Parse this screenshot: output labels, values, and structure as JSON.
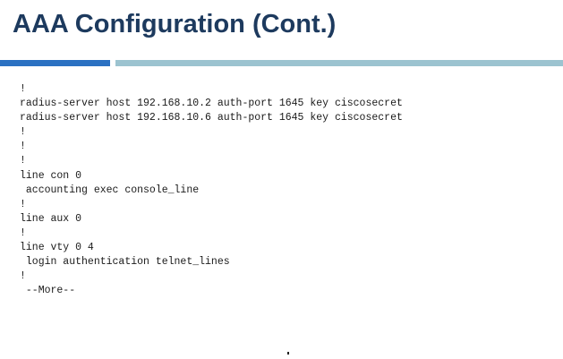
{
  "slide": {
    "title": "AAA Configuration (Cont.)"
  },
  "config_lines": [
    "!",
    "radius-server host 192.168.10.2 auth-port 1645 key ciscosecret",
    "radius-server host 192.168.10.6 auth-port 1645 key ciscosecret",
    "!",
    "!",
    "!",
    "line con 0",
    " accounting exec console_line",
    "!",
    "line aux 0",
    "!",
    "line vty 0 4",
    " login authentication telnet_lines",
    "!",
    " --More--"
  ],
  "colors": {
    "title": "#1d3a5e",
    "rule_accent": "#2b71c2",
    "rule_secondary": "#9cc3d0"
  }
}
